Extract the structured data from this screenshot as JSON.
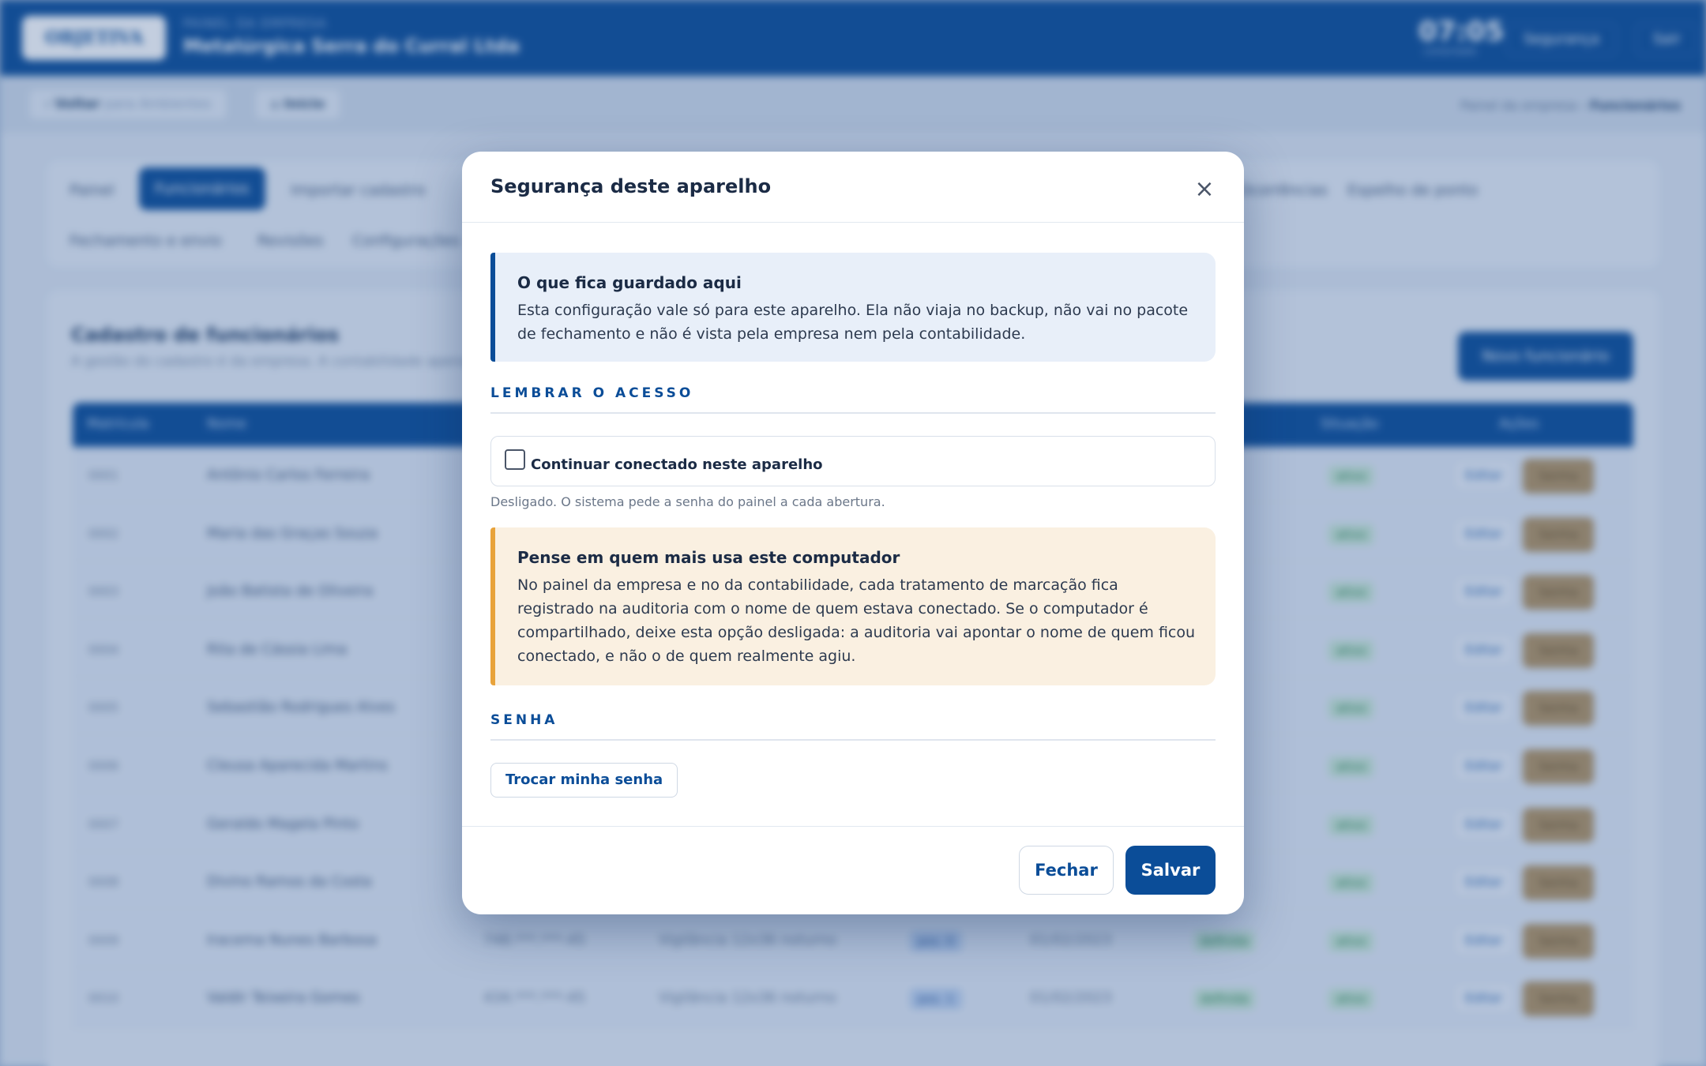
{
  "app": {
    "logo": "OBJETIVA",
    "company_kicker": "PAINEL DA EMPRESA",
    "company_name": "Metalúrgica Serra do Curral Ltda",
    "clock": "07:05",
    "clock_sub": "conectado",
    "security_label": "Segurança",
    "exit_label": "Sair",
    "back_label": "Voltar",
    "back_detail": "para Ambientes",
    "home_label": "Início",
    "breadcrumb_parent": "Painel da empresa",
    "breadcrumb_current": "Funcionários",
    "tabs_row1": [
      "Painel",
      "Funcionários",
      "Importar cadastro",
      "Ocorrências",
      "Espelho de ponto"
    ],
    "tabs_row2": [
      "Fechamento e envio",
      "Revisões",
      "Configurações"
    ],
    "list_title": "Cadastro de funcionários",
    "list_sub": "A gestão do cadastro é da empresa. A contabilidade apenas consulta.",
    "new_button": "Novo funcionário",
    "columns": [
      "Matrícula",
      "Nome",
      "Situação",
      "Ações"
    ],
    "rows": [
      {
        "mat": "0001",
        "nome": "Antônio Carlos Ferreira"
      },
      {
        "mat": "0002",
        "nome": "Maria das Graças Souza"
      },
      {
        "mat": "0003",
        "nome": "João Batista de Oliveira"
      },
      {
        "mat": "0004",
        "nome": "Rita de Cássia Lima"
      },
      {
        "mat": "0005",
        "nome": "Sebastião Rodrigues Alves"
      },
      {
        "mat": "0006",
        "nome": "Cleusa Aparecida Martins"
      },
      {
        "mat": "0007",
        "nome": "Geraldo Magela Pinto"
      },
      {
        "mat": "0008",
        "nome": "Divino Ramos da Costa"
      },
      {
        "mat": "0009",
        "nome": "Iracema Nunes Barbosa",
        "cpf": "748.***.***-45",
        "jornada": "Vigilância 12x36 noturno",
        "jtag": "pos. 0",
        "admissao": "01/02/2023",
        "escala": "definida"
      },
      {
        "mat": "0010",
        "nome": "Valdir Teixeira Gomes",
        "cpf": "434.***.***-45",
        "jornada": "Vigilância 12x36 noturno",
        "jtag": "pos. 1",
        "admissao": "01/02/2023",
        "escala": "definida"
      }
    ],
    "status_active": "ativo",
    "edit_label": "Editar",
    "password_label": "Senha"
  },
  "modal": {
    "title": "Segurança deste aparelho",
    "close_glyph": "×",
    "info_title": "O que fica guardado aqui",
    "info_body": "Esta configuração vale só para este aparelho. Ela não viaja no backup, não vai no pacote de fechamento e não é vista pela empresa nem pela contabilidade.",
    "section_access": "LEMBRAR O ACESSO",
    "checkbox_label": "Continuar conectado neste aparelho",
    "checkbox_checked": false,
    "checkbox_hint": "Desligado. O sistema pede a senha do painel a cada abertura.",
    "warn_title": "Pense em quem mais usa este computador",
    "warn_body": "No painel da empresa e no da contabilidade, cada tratamento de marcação fica registrado na auditoria com o nome de quem estava conectado. Se o computador é compartilhado, deixe esta opção desligada: a auditoria vai apontar o nome de quem ficou conectado, e não o de quem realmente agiu.",
    "section_password": "SENHA",
    "change_password": "Trocar minha senha",
    "close_button": "Fechar",
    "save_button": "Salvar"
  },
  "colors": {
    "brand": "#0b4d98",
    "info_bg": "#e8eff9",
    "warn_bg": "#faf0e1",
    "warn_accent": "#e8a33b"
  }
}
